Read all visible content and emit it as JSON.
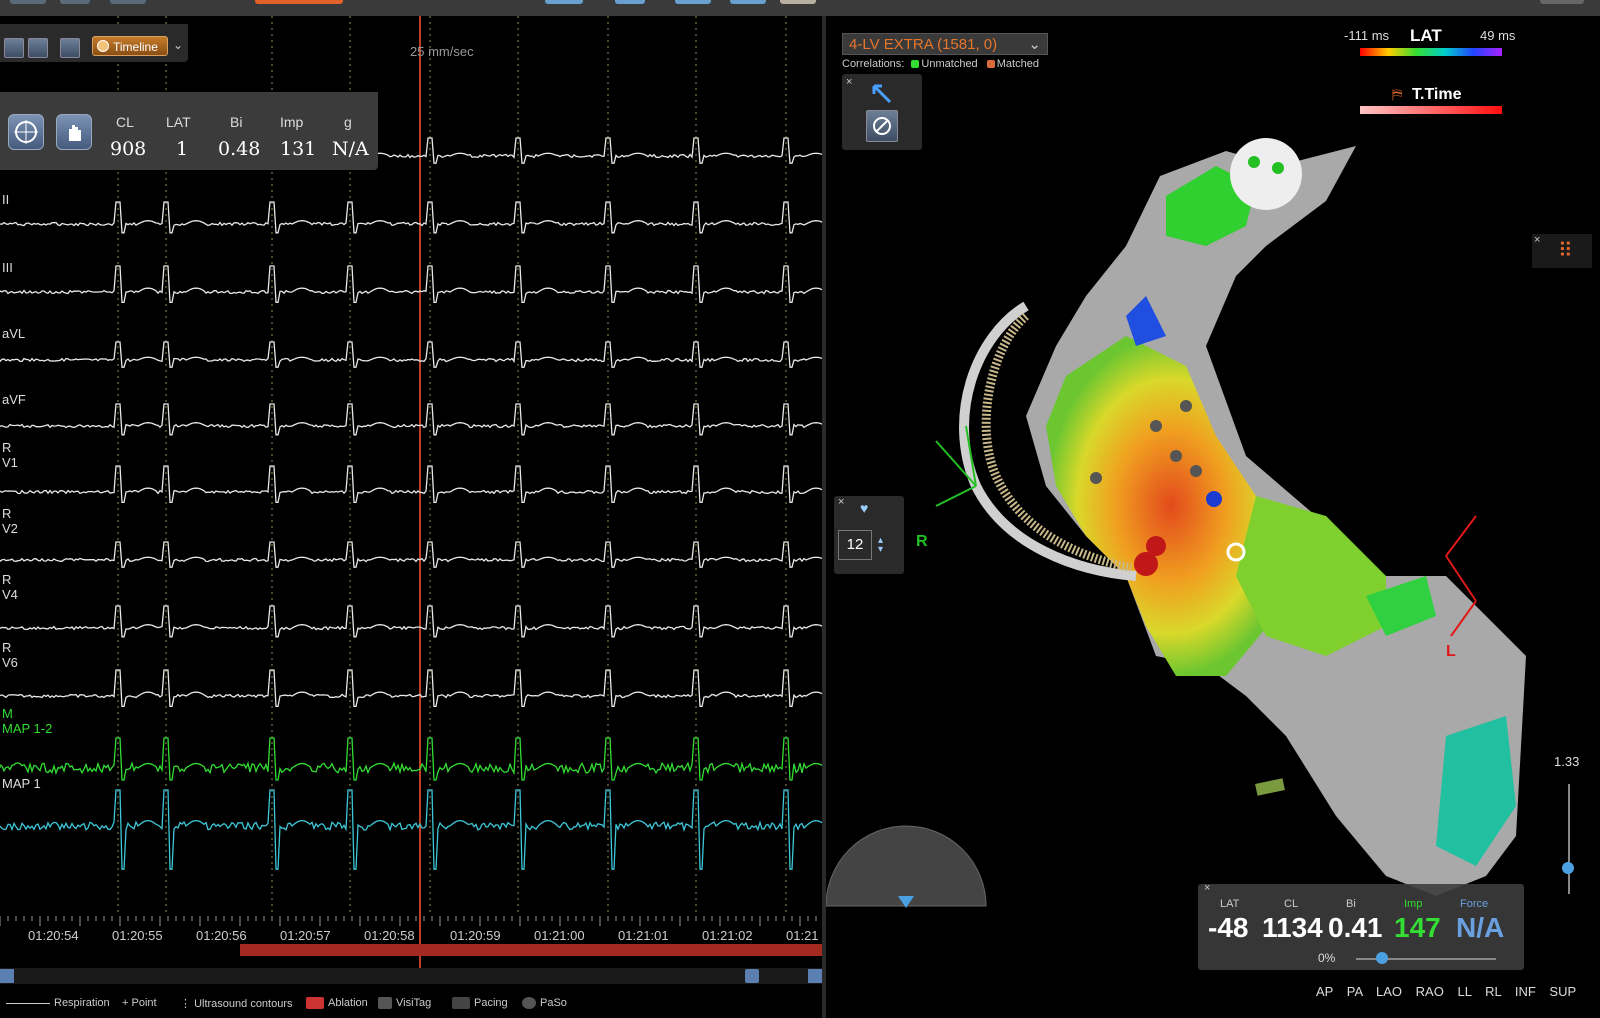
{
  "recording": {
    "speed_label": "25 mm/sec",
    "timeline_label": "Timeline",
    "params_headers": [
      "CL",
      "LAT",
      "Bi",
      "Imp",
      "g"
    ],
    "params_values": [
      "908",
      "1",
      "0.48",
      "131",
      "N/A"
    ],
    "leads": [
      "II",
      "III",
      "aVL",
      "aVF",
      "R\nV1",
      "R\nV2",
      "R\nV4",
      "R\nV6",
      "M\nMAP 1-2",
      "MAP 1"
    ],
    "times": [
      "01:20:54",
      "01:20:55",
      "01:20:56",
      "01:20:57",
      "01:20:58",
      "01:20:59",
      "01:21:00",
      "01:21:01",
      "01:21:02",
      "01:21"
    ],
    "legend": [
      "Respiration",
      "Point",
      "Ultrasound contours",
      "Ablation",
      "VisiTag",
      "Pacing",
      "PaSo"
    ]
  },
  "map": {
    "map_name": "4-LV EXTRA (1581, 0)",
    "correlations_label": "Correlations:",
    "unmatched_label": "Unmatched",
    "matched_label": "Matched",
    "lat_min": "-111 ms",
    "lat_title": "LAT",
    "lat_max": "49 ms",
    "ttime_label": "T.Time",
    "orient_r": "R",
    "orient_l": "L",
    "point_count": "12",
    "zoom_value": "1.33",
    "percent": "0%",
    "views": [
      "AP",
      "PA",
      "LAO",
      "RAO",
      "LL",
      "RL",
      "INF",
      "SUP"
    ]
  },
  "info_panel": {
    "headers": [
      "LAT",
      "CL",
      "Bi",
      "Imp",
      "Force"
    ],
    "values": [
      "-48",
      "1134",
      "0.41",
      "147",
      "N/A"
    ]
  },
  "colors": {
    "accent_orange": "#e8762a",
    "trace_green": "#33dd33",
    "trace_cyan": "#3ec7d8",
    "cursor_red": "#ff5533",
    "ablation_red": "#a32a20"
  }
}
